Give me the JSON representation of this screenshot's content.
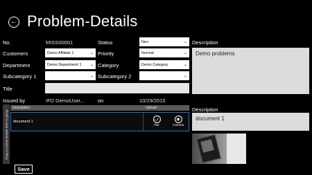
{
  "header": {
    "title": "Problem-Details",
    "back_icon": "arrow-left-icon"
  },
  "form": {
    "no_label": "No.",
    "no_value": "MISS00001",
    "customers_label": "Customers",
    "customers_value": "Demo Affiliate 1",
    "department_label": "Department",
    "department_value": "Demo Department 1",
    "subcategory1_label": "Subcategory 1",
    "subcategory1_value": "",
    "title_label": "Title",
    "title_value": "",
    "issued_by_label": "Issued by",
    "issued_by_value": "IFD DemoUser...",
    "on_label": "on",
    "on_value": "10/29/2015",
    "status_label": "Status",
    "status_value": "Neu",
    "priority_label": "Priority",
    "priority_value": "Normal",
    "category_label": "Category",
    "category_value": "Demo Category",
    "subcategory2_label": "Subcategory 2",
    "subcategory2_value": "",
    "description_label": "Description",
    "description_value": "Demo problems"
  },
  "documents": {
    "group_hint": "Drag a column header here to group",
    "columns": [
      "Description",
      "Upload"
    ],
    "rows": [
      {
        "description": "document 1",
        "file_label": "File",
        "camera_label": "Camera"
      }
    ],
    "detail_description_label": "Description",
    "detail_description_value": "document 1"
  },
  "footer": {
    "save_label": "Save"
  }
}
